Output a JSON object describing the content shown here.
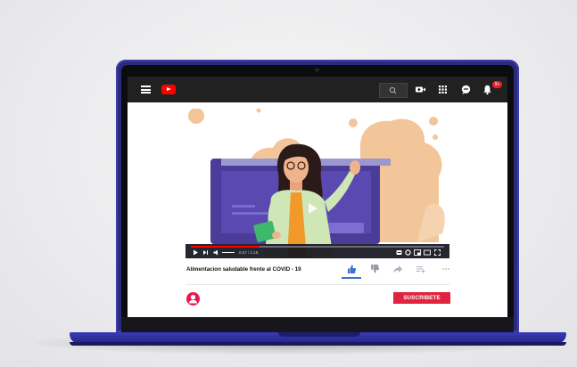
{
  "header": {
    "menu_icon": "hamburger-menu-icon",
    "logo_icon": "youtube-logo-icon",
    "icons": [
      "search-icon",
      "create-video-icon",
      "apps-grid-icon",
      "messages-icon",
      "notifications-bell-icon"
    ],
    "notification_count": "9+"
  },
  "player": {
    "time_text": "0:47 / 1:15",
    "progress": 0.27,
    "controls": [
      "play-icon",
      "next-icon",
      "volume-icon",
      "captions-icon",
      "settings-icon",
      "miniplayer-icon",
      "theater-icon",
      "fullscreen-icon"
    ]
  },
  "video": {
    "title": "Alimentacion saludable frente al COVID - 19",
    "actions": [
      "like-icon",
      "dislike-icon",
      "share-icon",
      "save-icon",
      "more-icon"
    ]
  },
  "channel": {
    "avatar_icon": "user-avatar-icon",
    "subscribe_label": "SUSCRIBETE"
  },
  "colors": {
    "accent": "#ff0000",
    "subscribe": "#e0233f",
    "laptop": "#2a2a7e",
    "video_bg_blob": "#f3c69a",
    "board": "#4b3c9a",
    "shirt": "#cfe6b6"
  }
}
